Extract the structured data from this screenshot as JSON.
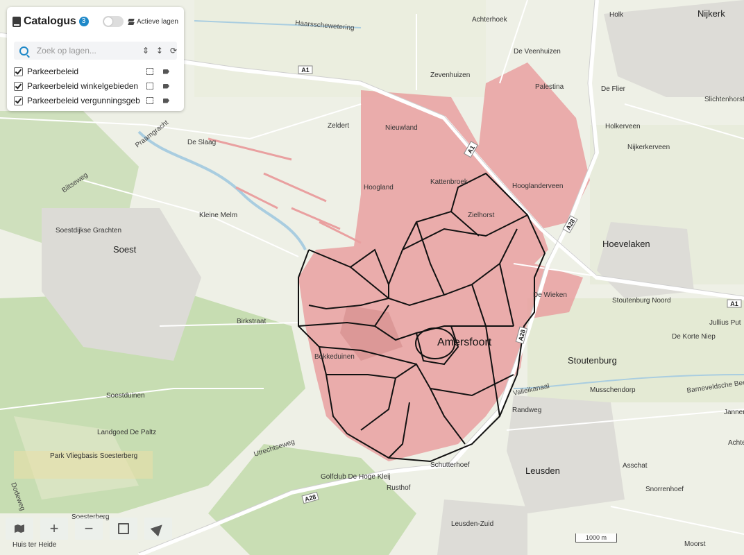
{
  "catalogus": {
    "title": "Catalogus",
    "badge_count": "3",
    "active_layers_label": "Actieve lagen",
    "active_layers_on": false,
    "search_placeholder": "Zoek op lagen...",
    "layers": [
      {
        "label": "Parkeerbeleid",
        "checked": true
      },
      {
        "label": "Parkeerbeleid winkelgebieden",
        "checked": true
      },
      {
        "label": "Parkeerbeleid vergunningsgeb",
        "checked": true
      }
    ]
  },
  "controls": {
    "zoom_in": "+",
    "zoom_out": "−"
  },
  "scalebar": "1000 m",
  "map_labels": {
    "haarsschewetering": "Haarsschewetering",
    "achterhoek": "Achterhoek",
    "holk": "Holk",
    "nijkerk": "Nijkerk",
    "de_veenhuizen": "De Veenhuizen",
    "zevenhuizen": "Zevenhuizen",
    "palestina": "Palestina",
    "de_flier": "De Flier",
    "slichtenhorst": "Slichtenhorst",
    "zeldert": "Zeldert",
    "nieuwland": "Nieuwland",
    "holkerveen": "Holkerveen",
    "praamgracht": "Praamgracht",
    "de_slaag": "De Slaag",
    "nijkerkerveen": "Nijkerkerveen",
    "bultseweg": "Biltseweg",
    "hoogland": "Hoogland",
    "kattenbroek": "Kattenbroek",
    "hooglanderveen": "Hooglanderveen",
    "kleine_melm": "Kleine Melm",
    "zielhorst": "Zielhorst",
    "soestdijkse_grachten": "Soestdijkse Grachten",
    "soest": "Soest",
    "hoevelaken": "Hoevelaken",
    "de_wieken": "De Wieken",
    "stoutenburg_noord": "Stoutenburg Noord",
    "birkstraat": "Birkstraat",
    "amersfoort": "Amersfoort",
    "de_korte_niep": "De Korte Niep",
    "jullius_put": "Jullius Put",
    "bokkeduinen": "Bokkeduinen",
    "stoutenburg": "Stoutenburg",
    "valleikanaal": "Valleikanaal",
    "barneveldsche_beek": "Barneveldsche Beek",
    "musschendorp": "Musschendorp",
    "soestduinen": "Soestduinen",
    "randweg": "Randweg",
    "jannens": "Jannen",
    "landgoed_de_paltz": "Landgoed De Paltz",
    "park_vliegbasis": "Park Vliegbasis Soesterberg",
    "utrechtseweg": "Utrechtseweg",
    "schutterhoef": "Schutterhoef",
    "asschat": "Asschat",
    "golfclub": "Golfclub De Hoge Kleij",
    "leusden": "Leusden",
    "rusthof": "Rusthof",
    "snorrenhoef": "Snorrenhoef",
    "soesterberg": "Soesterberg",
    "huis_ter_heide": "Huis ter Heide",
    "leusden_zuid": "Leusden-Zuid",
    "moorst": "Moorst",
    "dodeweg": "Dodeweg",
    "achter": "Achte",
    "stoutenburg_label": "Stoutenburg"
  },
  "road_shields": {
    "a1_west": "A1",
    "a1_mid": "A1",
    "a1_east": "A1",
    "a28_north": "A28",
    "a28_east": "A28",
    "a28_south": "A28"
  },
  "colors": {
    "base": "#eef0e6",
    "forest": "#c5dcb0",
    "meadow": "#e3ead4",
    "urban_grey": "#d9d8d4",
    "parking_fill": "#e9a0a0",
    "boundary": "#111111",
    "water": "#a9cde0",
    "motorway": "#ffffff"
  }
}
